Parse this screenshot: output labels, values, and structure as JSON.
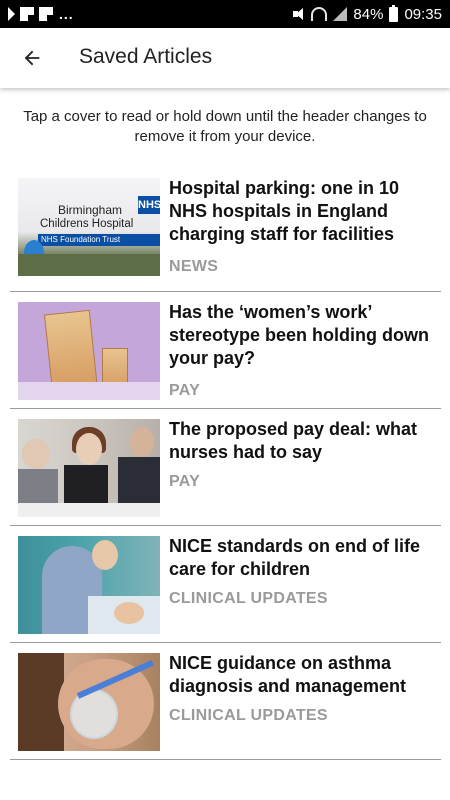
{
  "status_bar": {
    "battery": "84%",
    "time": "09:35",
    "left_icons": [
      "tv-icon",
      "flipboard-icon",
      "flipboard-icon"
    ],
    "right_icons": [
      "mute-icon",
      "wifi-icon",
      "signal-icon",
      "battery-icon"
    ]
  },
  "header": {
    "back_icon": "arrow-left-icon",
    "title": "Saved Articles"
  },
  "instructions": "Tap a cover to read or hold down until the header changes to remove it from your device.",
  "articles": [
    {
      "title": "Hospital parking: one in 10 NHS hospitals in England charging staff for facilities",
      "category": "NEWS",
      "cover_text": {
        "nhs": "NHS",
        "line1": "Birmingham",
        "line2": "Childrens Hospital",
        "line3": "NHS Foundation Trust"
      }
    },
    {
      "title": "Has the ‘women’s work’ stereotype been holding down your pay?",
      "category": "PAY"
    },
    {
      "title": "The proposed pay deal: what nurses had to say",
      "category": "PAY"
    },
    {
      "title": "NICE standards on end of life care for children",
      "category": "CLINICAL UPDATES"
    },
    {
      "title": "NICE guidance on asthma diagnosis and management",
      "category": "CLINICAL UPDATES"
    }
  ],
  "colors": {
    "category_gray": "#9a9a9a",
    "divider": "#9a9a9a",
    "status_bar_bg": "#000000"
  }
}
